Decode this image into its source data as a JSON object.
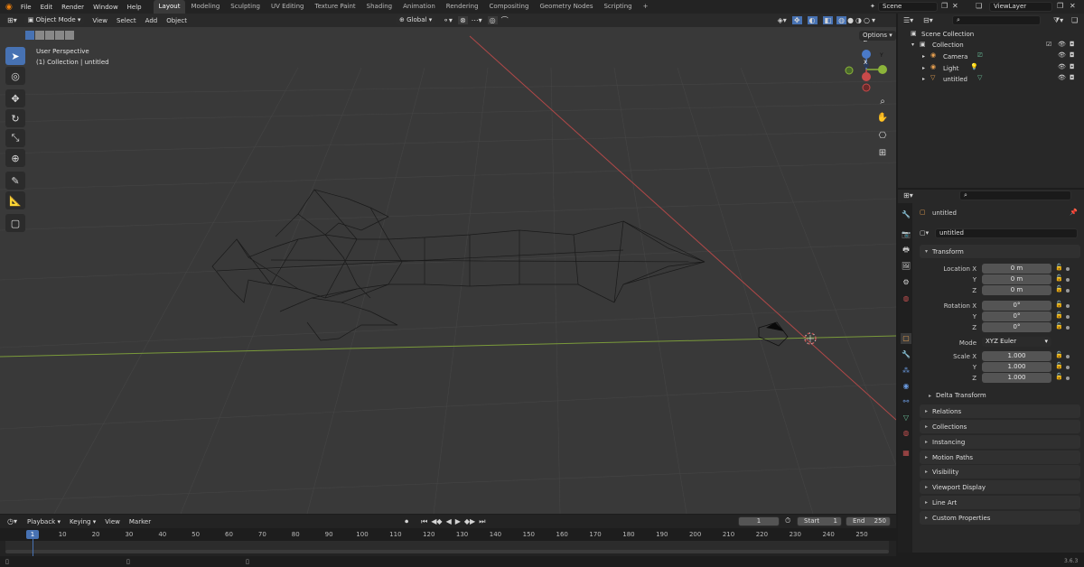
{
  "topbar": {
    "menus": [
      "File",
      "Edit",
      "Render",
      "Window",
      "Help"
    ],
    "workspaces": [
      "Layout",
      "Modeling",
      "Sculpting",
      "UV Editing",
      "Texture Paint",
      "Shading",
      "Animation",
      "Rendering",
      "Compositing",
      "Geometry Nodes",
      "Scripting"
    ],
    "active_workspace": "Layout",
    "add_tab": "+",
    "scene": "Scene",
    "view_layer": "ViewLayer"
  },
  "viewport": {
    "mode": "Object Mode",
    "menus": [
      "View",
      "Select",
      "Add",
      "Object"
    ],
    "transform_orientation": "Global",
    "options": "Options",
    "overlay_title": "User Perspective",
    "overlay_subtitle": "(1) Collection | untitled",
    "gizmo": {
      "z": "Z",
      "y": "Y",
      "x": "X"
    }
  },
  "outliner": {
    "root": "Scene Collection",
    "collection": "Collection",
    "items": [
      "Camera",
      "Light",
      "untitled"
    ]
  },
  "properties": {
    "object_name": "untitled",
    "data_name": "untitled",
    "transform_label": "Transform",
    "location": {
      "label_x": "Location X",
      "label_y": "Y",
      "label_z": "Z",
      "x": "0 m",
      "y": "0 m",
      "z": "0 m"
    },
    "rotation": {
      "label_x": "Rotation X",
      "label_y": "Y",
      "label_z": "Z",
      "x": "0°",
      "y": "0°",
      "z": "0°"
    },
    "mode_label": "Mode",
    "mode_value": "XYZ Euler",
    "scale": {
      "label_x": "Scale X",
      "label_y": "Y",
      "label_z": "Z",
      "x": "1.000",
      "y": "1.000",
      "z": "1.000"
    },
    "delta_transform": "Delta Transform",
    "panels": [
      "Relations",
      "Collections",
      "Instancing",
      "Motion Paths",
      "Visibility",
      "Viewport Display",
      "Line Art",
      "Custom Properties"
    ]
  },
  "timeline": {
    "menus": [
      "Playback",
      "Keying",
      "View",
      "Marker"
    ],
    "current_frame": "1",
    "start_label": "Start",
    "start": "1",
    "end_label": "End",
    "end": "250",
    "ruler": [
      "1",
      "10",
      "20",
      "30",
      "40",
      "50",
      "60",
      "70",
      "80",
      "90",
      "100",
      "110",
      "120",
      "130",
      "140",
      "150",
      "160",
      "170",
      "180",
      "190",
      "200",
      "210",
      "220",
      "230",
      "240",
      "250"
    ],
    "playhead": "1"
  },
  "status": {
    "version": "3.6.3"
  }
}
